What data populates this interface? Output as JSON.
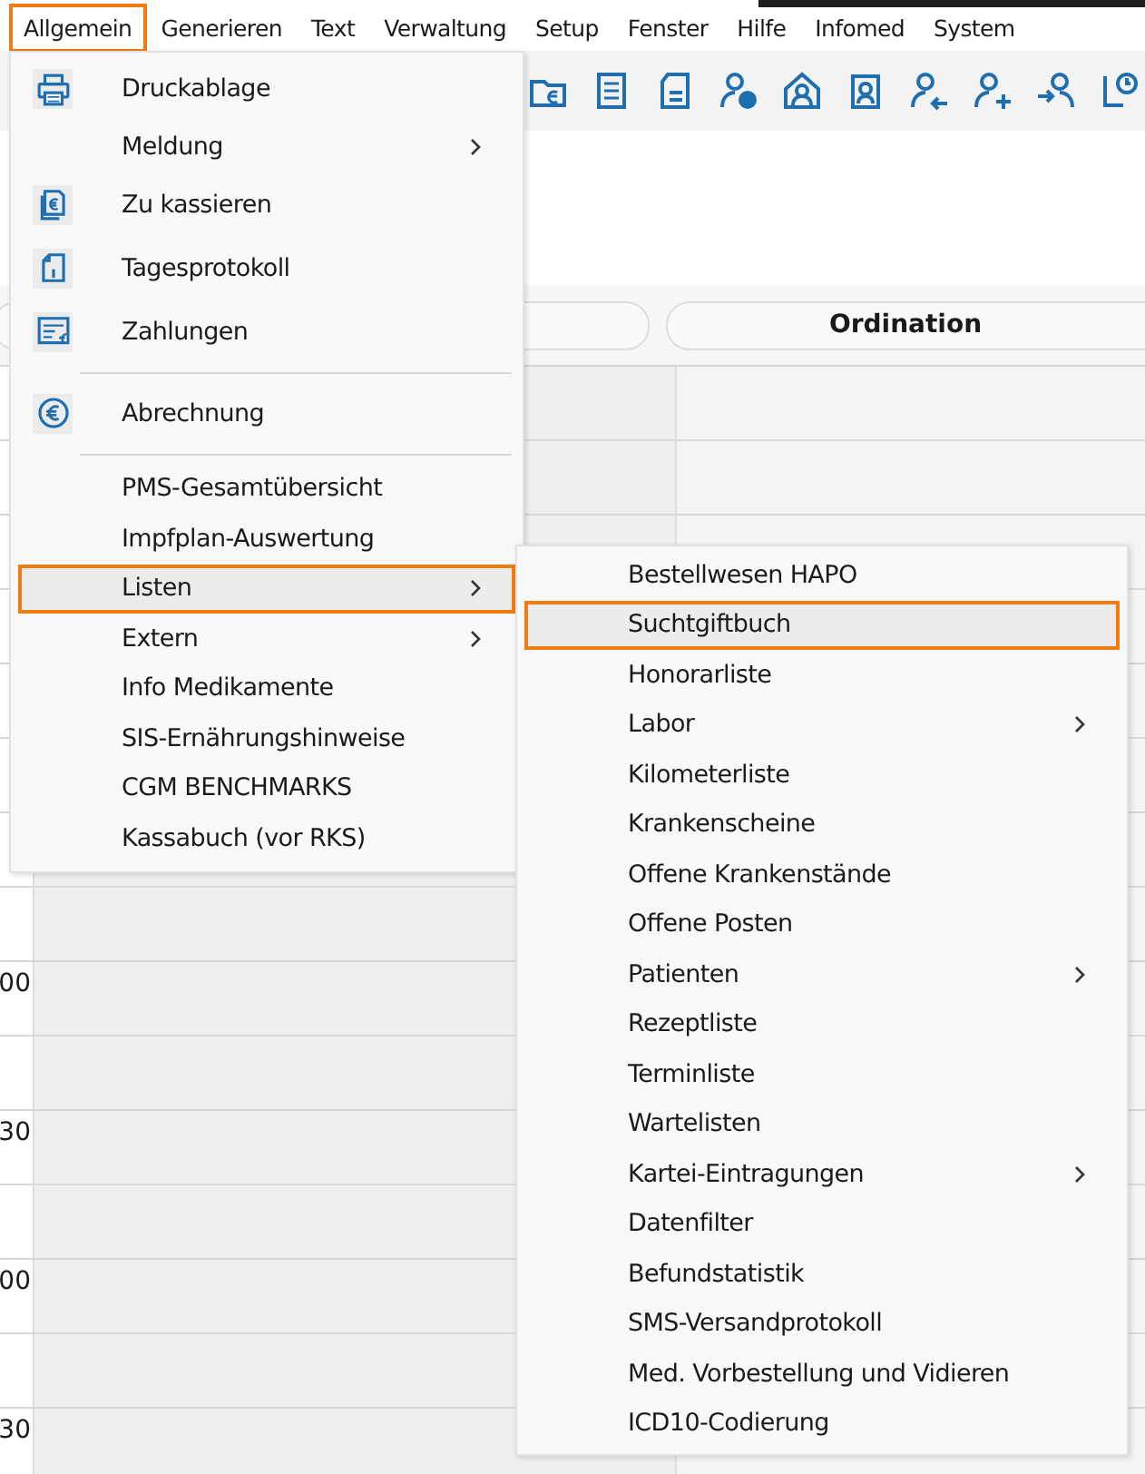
{
  "menubar": [
    {
      "label": "Allgemein",
      "selected": true
    },
    {
      "label": "Generieren",
      "selected": false
    },
    {
      "label": "Text",
      "selected": false
    },
    {
      "label": "Verwaltung",
      "selected": false
    },
    {
      "label": "Setup",
      "selected": false
    },
    {
      "label": "Fenster",
      "selected": false
    },
    {
      "label": "Hilfe",
      "selected": false
    },
    {
      "label": "Infomed",
      "selected": false
    },
    {
      "label": "System",
      "selected": false
    }
  ],
  "column_header": "Ordination",
  "time_labels": [
    "00",
    "30",
    "00",
    "30"
  ],
  "menu": [
    {
      "kind": "icon",
      "label": "Druckablage",
      "submenu": false,
      "selected": false
    },
    {
      "kind": "plain",
      "label": "Meldung",
      "submenu": true,
      "selected": false
    },
    {
      "kind": "icon",
      "label": "Zu kassieren",
      "submenu": false,
      "selected": false
    },
    {
      "kind": "icon",
      "label": "Tagesprotokoll",
      "submenu": false,
      "selected": false
    },
    {
      "kind": "icon",
      "label": "Zahlungen",
      "submenu": false,
      "selected": false
    },
    {
      "kind": "separator"
    },
    {
      "kind": "icon",
      "label": "Abrechnung",
      "submenu": false,
      "selected": false
    },
    {
      "kind": "separator"
    },
    {
      "kind": "plain",
      "label": "PMS-Gesamtübersicht",
      "submenu": false,
      "selected": false
    },
    {
      "kind": "plain",
      "label": "Impfplan-Auswertung",
      "submenu": false,
      "selected": false
    },
    {
      "kind": "plain",
      "label": "Listen",
      "submenu": true,
      "selected": true
    },
    {
      "kind": "plain",
      "label": "Extern",
      "submenu": true,
      "selected": false
    },
    {
      "kind": "plain",
      "label": "Info Medikamente",
      "submenu": false,
      "selected": false
    },
    {
      "kind": "plain",
      "label": "SIS-Ernährungshinweise",
      "submenu": false,
      "selected": false
    },
    {
      "kind": "plain",
      "label": "CGM BENCHMARKS",
      "submenu": false,
      "selected": false
    },
    {
      "kind": "plain",
      "label": "Kassabuch (vor RKS)",
      "submenu": false,
      "selected": false
    }
  ],
  "submenu": [
    {
      "label": "Bestellwesen HAPO",
      "submenu": false,
      "selected": false
    },
    {
      "label": "Suchtgiftbuch",
      "submenu": false,
      "selected": true
    },
    {
      "label": "Honorarliste",
      "submenu": false,
      "selected": false
    },
    {
      "label": "Labor",
      "submenu": true,
      "selected": false
    },
    {
      "label": "Kilometerliste",
      "submenu": false,
      "selected": false
    },
    {
      "label": "Krankenscheine",
      "submenu": false,
      "selected": false
    },
    {
      "label": "Offene Krankenstände",
      "submenu": false,
      "selected": false
    },
    {
      "label": "Offene Posten",
      "submenu": false,
      "selected": false
    },
    {
      "label": "Patienten",
      "submenu": true,
      "selected": false
    },
    {
      "label": "Rezeptliste",
      "submenu": false,
      "selected": false
    },
    {
      "label": "Terminliste",
      "submenu": false,
      "selected": false
    },
    {
      "label": "Wartelisten",
      "submenu": false,
      "selected": false
    },
    {
      "label": "Kartei-Eintragungen",
      "submenu": true,
      "selected": false
    },
    {
      "label": "Datenfilter",
      "submenu": false,
      "selected": false
    },
    {
      "label": "Befundstatistik",
      "submenu": false,
      "selected": false
    },
    {
      "label": "SMS-Versandprotokoll",
      "submenu": false,
      "selected": false
    },
    {
      "label": "Med. Vorbestellung und Vidieren",
      "submenu": false,
      "selected": false
    },
    {
      "label": "ICD10-Codierung",
      "submenu": false,
      "selected": false
    }
  ]
}
